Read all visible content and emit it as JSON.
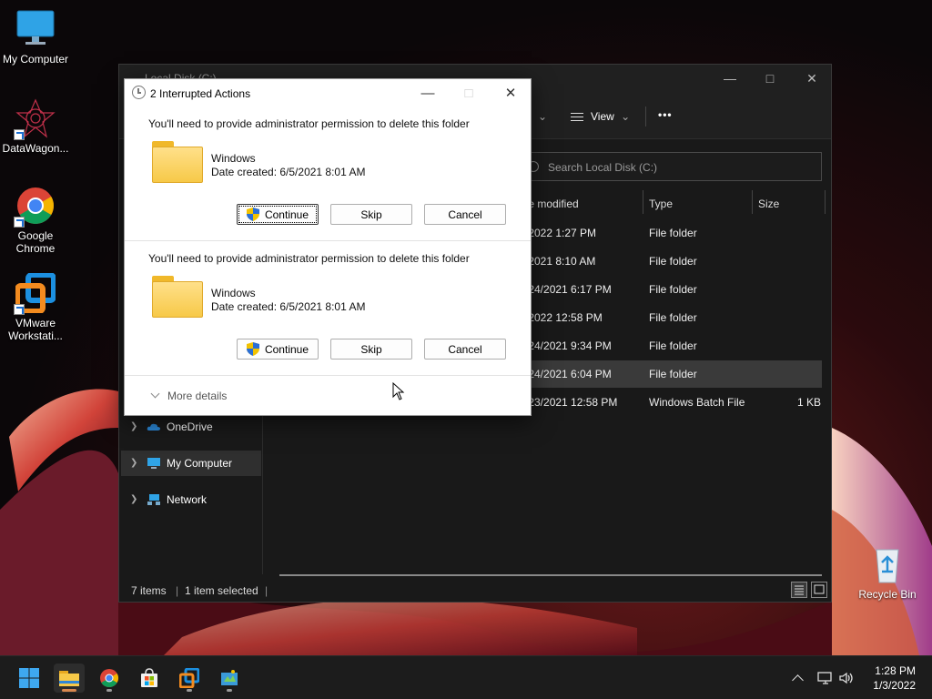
{
  "desktop": {
    "icons": [
      {
        "label": "My Computer"
      },
      {
        "label": "DataWagon..."
      },
      {
        "label": "Google Chrome"
      },
      {
        "label": "VMware Workstati..."
      },
      {
        "label": "Recycle Bin"
      }
    ]
  },
  "explorer": {
    "title": "Local Disk (C:)",
    "toolbar": {
      "view_label": "View",
      "more": "•••"
    },
    "search_placeholder": "Search Local Disk (C:)",
    "columns": [
      "te modified",
      "Type",
      "Size"
    ],
    "rows": [
      {
        "modified": "/2022 1:27 PM",
        "type": "File folder",
        "size": ""
      },
      {
        "modified": "/2021 8:10 AM",
        "type": "File folder",
        "size": ""
      },
      {
        "modified": "/24/2021 6:17 PM",
        "type": "File folder",
        "size": ""
      },
      {
        "modified": "/2022 12:58 PM",
        "type": "File folder",
        "size": ""
      },
      {
        "modified": "/24/2021 9:34 PM",
        "type": "File folder",
        "size": ""
      },
      {
        "modified": "/24/2021 6:04 PM",
        "type": "File folder",
        "size": "",
        "selected": true
      },
      {
        "modified": "/23/2021 12:58 PM",
        "type": "Windows Batch File",
        "size": "1 KB"
      }
    ],
    "nav": [
      {
        "label": "OneDrive"
      },
      {
        "label": "My Computer",
        "selected": true
      },
      {
        "label": "Network"
      }
    ],
    "status": {
      "items": "7 items",
      "selected": "1 item selected",
      "sep": "|"
    }
  },
  "dialog": {
    "title": "2 Interrupted Actions",
    "sections": [
      {
        "message": "You'll need to provide administrator permission to delete this folder",
        "file_name": "Windows",
        "file_date": "Date created: 6/5/2021 8:01 AM",
        "continue_label": "Continue",
        "skip_label": "Skip",
        "cancel_label": "Cancel"
      },
      {
        "message": "You'll need to provide administrator permission to delete this folder",
        "file_name": "Windows",
        "file_date": "Date created: 6/5/2021 8:01 AM",
        "continue_label": "Continue",
        "skip_label": "Skip",
        "cancel_label": "Cancel"
      }
    ],
    "more_details": "More details"
  },
  "taskbar": {
    "time": "1:28 PM",
    "date": "1/3/2022"
  },
  "colors": {
    "accent": "#0078d4",
    "folder_yellow": "#f7c948",
    "taskbar_bg": "#1c1c1c",
    "explorer_bg": "#191919"
  }
}
